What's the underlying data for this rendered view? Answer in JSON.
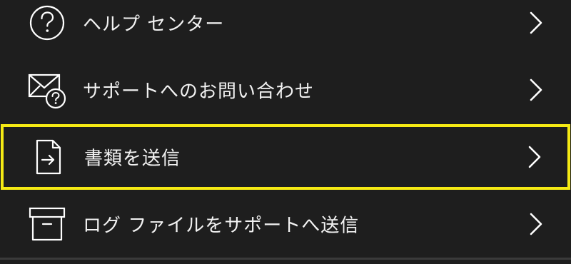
{
  "menu": {
    "items": [
      {
        "label": "ヘルプ センター",
        "icon": "help-circle-icon"
      },
      {
        "label": "サポートへのお問い合わせ",
        "icon": "mail-question-icon"
      },
      {
        "label": "書類を送信",
        "icon": "send-document-icon"
      },
      {
        "label": "ログ ファイルをサポートへ送信",
        "icon": "archive-box-icon"
      }
    ]
  },
  "colors": {
    "background": "#1e1e1e",
    "text": "#f2f2f2",
    "highlight": "#f5ea14",
    "icon_stroke": "#ffffff"
  }
}
